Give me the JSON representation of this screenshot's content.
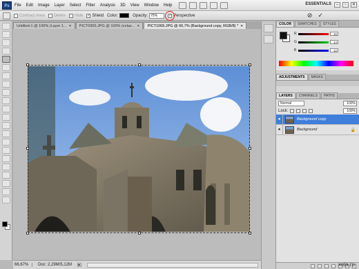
{
  "menubar": {
    "logo": "Ps",
    "items": [
      "File",
      "Edit",
      "Image",
      "Layer",
      "Select",
      "Filter",
      "Analysis",
      "3D",
      "View",
      "Window",
      "Help"
    ],
    "workspace": "ESSENTIALS",
    "window_buttons": [
      "–",
      "▫",
      "✕"
    ]
  },
  "options_bar": {
    "contract_area": "Contract Area",
    "delete": "Delete",
    "hide": "Hide",
    "shield": "Shield",
    "color": "Color:",
    "opacity_label": "Opacity:",
    "opacity_value": "75%",
    "perspective": "Perspective",
    "cancel_icon": "⊘",
    "commit_icon": "✓"
  },
  "tabs": [
    {
      "label": "Untitled-1 @ 100% (Layer 1...",
      "active": false
    },
    {
      "label": "PICT0955.JPG @ 100% (volaz...",
      "active": false
    },
    {
      "label": "PICT1069.JPG @ 66,7% (Background copy, RGB/8) *",
      "active": true
    }
  ],
  "status": {
    "zoom": "66,67%",
    "doc": "Doc: 2,29M/5,12M"
  },
  "watermark": "xela.ru",
  "color_panel": {
    "tabs": [
      "COLOR",
      "SWATCHES",
      "STYLES"
    ],
    "sliders": [
      {
        "label": "R",
        "value": "15",
        "color": "#ff0000"
      },
      {
        "label": "G",
        "value": "14",
        "color": "#00cc00"
      },
      {
        "label": "B",
        "value": "12",
        "color": "#0000ff"
      }
    ]
  },
  "adjustments_panel": {
    "tabs": [
      "ADJUSTMENTS",
      "MASKS"
    ]
  },
  "layers_panel": {
    "tabs": [
      "LAYERS",
      "CHANNELS",
      "PATHS"
    ],
    "blend_mode": "Normal",
    "opacity": "100%",
    "lock_label": "Lock:",
    "fill": "100%",
    "layers": [
      {
        "name": "Background copy",
        "selected": true,
        "locked": false
      },
      {
        "name": "Background",
        "selected": false,
        "locked": true
      }
    ]
  },
  "colors": {
    "accent_selected": "#3f7edb",
    "highlight_circle": "#dd2222"
  }
}
